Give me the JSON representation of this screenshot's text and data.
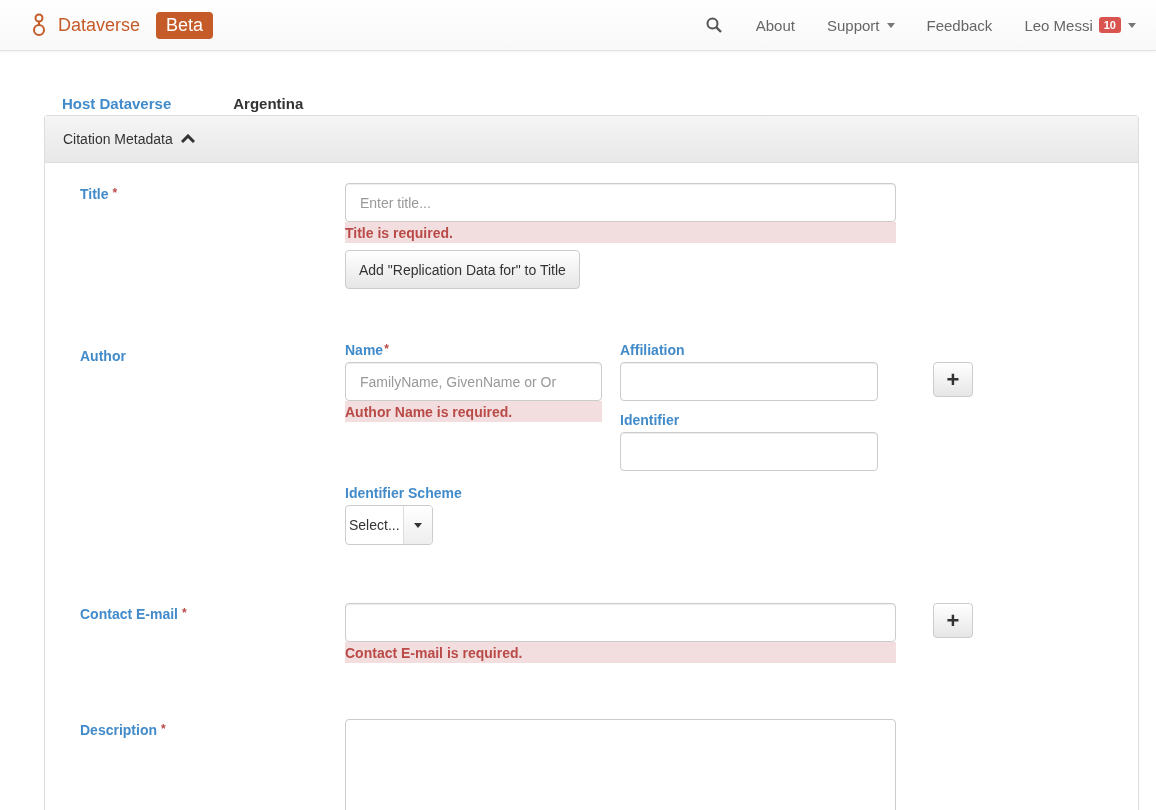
{
  "navbar": {
    "brand": "Dataverse",
    "badge": "Beta",
    "items": [
      {
        "kind": "search"
      },
      {
        "kind": "link",
        "label": "About",
        "dropdown": false
      },
      {
        "kind": "link",
        "label": "Support",
        "dropdown": true
      },
      {
        "kind": "link",
        "label": "Feedback",
        "dropdown": false
      }
    ],
    "user": {
      "name": "Leo Messi",
      "notifications": "10",
      "dropdown": true
    }
  },
  "host": {
    "label": "Host Dataverse",
    "value": "Argentina"
  },
  "section": {
    "title": "Citation Metadata",
    "expanded": true
  },
  "fields": [
    {
      "kind": "text",
      "label": "Title",
      "required_mark": "*",
      "placeholder": "Enter title...",
      "error": "Title is required.",
      "button": "Add \"Replication Data for\" to Title"
    },
    {
      "kind": "compound",
      "label": "Author",
      "name": {
        "label": "Name",
        "required_mark": "*",
        "placeholder": "FamilyName, GivenName or Or",
        "error": "Author Name is required."
      },
      "affiliation": {
        "label": "Affiliation"
      },
      "identifier": {
        "label": "Identifier"
      },
      "scheme": {
        "label": "Identifier Scheme",
        "value": "Select..."
      },
      "add_button": "+"
    },
    {
      "kind": "text",
      "label": "Contact E-mail",
      "required_mark": "*",
      "error": "Contact E-mail is required.",
      "add_button": "+"
    },
    {
      "kind": "textarea",
      "label": "Description",
      "required_mark": "*"
    }
  ]
}
